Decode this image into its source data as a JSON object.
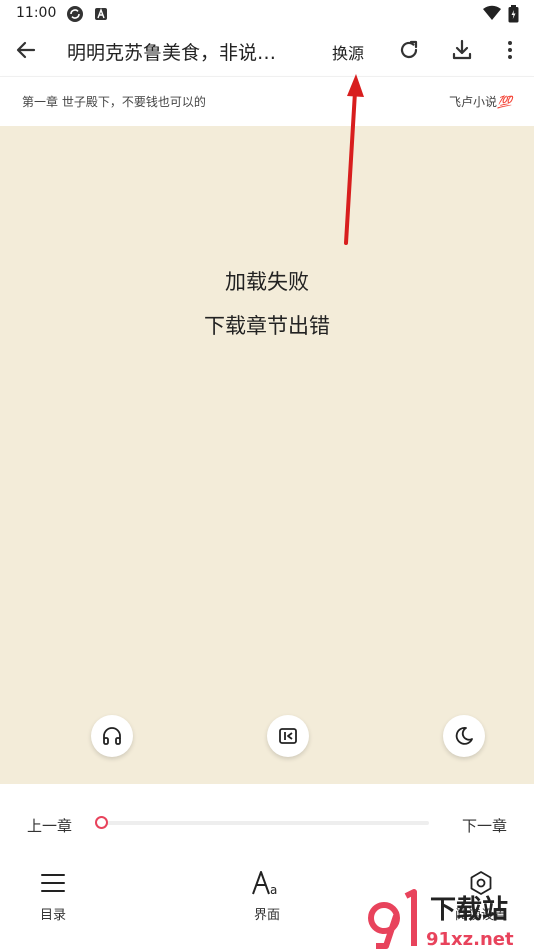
{
  "status_bar": {
    "time": "11:00"
  },
  "app_bar": {
    "title": "明明克苏鲁美食，非说…",
    "source_label": "换源"
  },
  "chapter_bar": {
    "chapter_title": "第一章 世子殿下，不要钱也可以的",
    "app_name": "飞卢小说",
    "app_badge": "💯"
  },
  "reader": {
    "error_title": "加载失败",
    "error_detail": "下载章节出错"
  },
  "chapter_nav": {
    "prev_label": "上一章",
    "next_label": "下一章",
    "progress": 0
  },
  "bottom_nav": {
    "items": [
      {
        "label": "目录",
        "icon": "menu-icon"
      },
      {
        "label": "界面",
        "icon": "font-icon"
      },
      {
        "label": "阅读设置",
        "icon": "settings-hex-icon"
      }
    ]
  },
  "watermark": {
    "brand": "下载站",
    "site": "91xz.net"
  },
  "colors": {
    "accent": "#e8435c",
    "reader_bg": "#f3ecd9",
    "annotation_arrow": "#d81e1e"
  }
}
